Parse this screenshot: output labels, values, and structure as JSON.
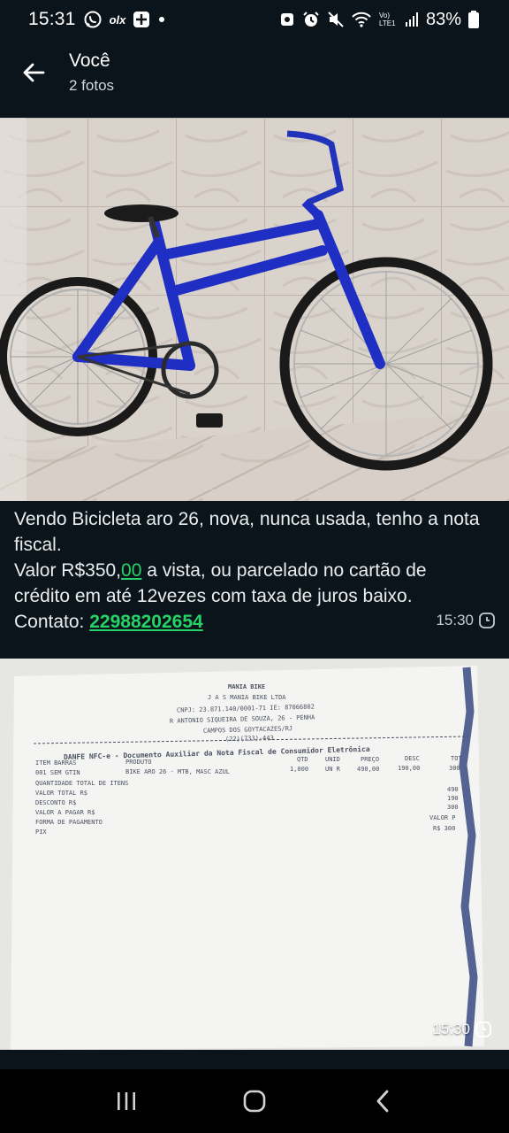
{
  "status_bar": {
    "time": "15:31",
    "olx_label": "olx",
    "lte_label": "Vo)\nLTE1",
    "battery": "83%"
  },
  "header": {
    "title": "Você",
    "subtitle": "2 fotos"
  },
  "photo1": {
    "caption_line1": "Vendo Bicicleta aro 26, nova, nunca usada, tenho a nota fiscal.",
    "caption_value_prefix": "Valor R$350,",
    "caption_value_cents": "00",
    "caption_value_suffix": " a vista, ou parcelado no cartão de crédito em até 12vezes com taxa de juros baixo.",
    "caption_contact_prefix": "Contato: ",
    "caption_phone": "22988202654",
    "time": "15:30"
  },
  "photo2": {
    "time": "15:30",
    "receipt": {
      "store": "MANIA BIKE",
      "company": "J A S MANIA BIKE LTDA",
      "cnpj": "CNPJ: 23.871.140/0001-71 IE: 87066802",
      "address": "R ANTONIO SIQUEIRA DE SOUZA, 26 - PENHA",
      "city": "CAMPOS DOS GOYTACAZES/RJ",
      "phone": "(22)(733)-443",
      "danfe": "DANFE NFC-e - Documento Auxiliar da Nota Fiscal de Consumidor Eletrônica",
      "col_item": "ITEM BARRAS",
      "col_prod": "PRODUTO",
      "col_qtd": "QTD",
      "col_unid": "UNID",
      "col_preco": "PREÇO",
      "col_desc": "DESC",
      "col_total": "TOT",
      "row_item": "001 SEM GTIN",
      "row_prod": "BIKE ARO 26 - MTB, MASC AZUL",
      "row_qtd": "1,000",
      "row_unid": "UN R",
      "row_preco": "490,00",
      "row_desc": "190,00",
      "row_total": "300",
      "l1": "QUANTIDADE TOTAL DE ITENS",
      "l2": "VALOR TOTAL R$",
      "l3": "DESCONTO R$",
      "l4": "VALOR A PAGAR R$",
      "l5": "FORMA DE PAGAMENTO",
      "l6": "PIX",
      "r1": "490",
      "r2": "190",
      "r3": "300",
      "r4": "VALOR P",
      "r5": "R$ 300"
    }
  },
  "colors": {
    "background": "#0b141a",
    "link_green": "#25d366",
    "text": "#e9edef",
    "bike_blue": "#1f2fc4"
  }
}
